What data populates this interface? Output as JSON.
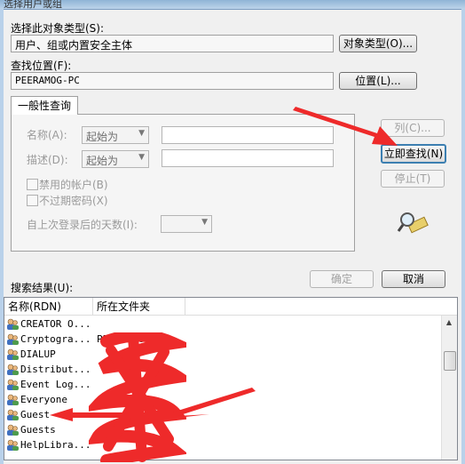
{
  "window": {
    "title": "选择用户或组"
  },
  "object_type": {
    "label": "选择此对象类型(S):",
    "value": "用户、组或内置安全主体",
    "button": "对象类型(O)..."
  },
  "location": {
    "label": "查找位置(F):",
    "value": "PEERAMOG-PC",
    "button": "位置(L)..."
  },
  "query": {
    "tab": "一般性查询",
    "name_label": "名称(A):",
    "name_mode": "起始为",
    "desc_label": "描述(D):",
    "desc_mode": "起始为",
    "disabled_accounts": "禁用的帐户(B)",
    "no_expire_pwd": "不过期密码(X)",
    "days_label": "自上次登录后的天数(I):"
  },
  "buttons": {
    "columns": "列(C)...",
    "find_now": "立即查找(N)",
    "stop": "停止(T)",
    "ok": "确定",
    "cancel": "取消"
  },
  "results": {
    "label": "搜索结果(U):",
    "columns": [
      "名称(RDN)",
      "所在文件夹"
    ],
    "rows": [
      {
        "name": "CREATOR O...",
        "folder": ""
      },
      {
        "name": "Cryptogra...",
        "folder": "PEERAMOG-PC"
      },
      {
        "name": "DIALUP",
        "folder": ""
      },
      {
        "name": "Distribut...",
        "folder": ""
      },
      {
        "name": "Event Log...",
        "folder": ""
      },
      {
        "name": "Everyone",
        "folder": ""
      },
      {
        "name": "Guest",
        "folder": ""
      },
      {
        "name": "Guests",
        "folder": ""
      },
      {
        "name": "HelpLibra...",
        "folder": ""
      }
    ]
  },
  "colors": {
    "annotation": "#ee2a2a",
    "focus": "#3c7fb1"
  }
}
